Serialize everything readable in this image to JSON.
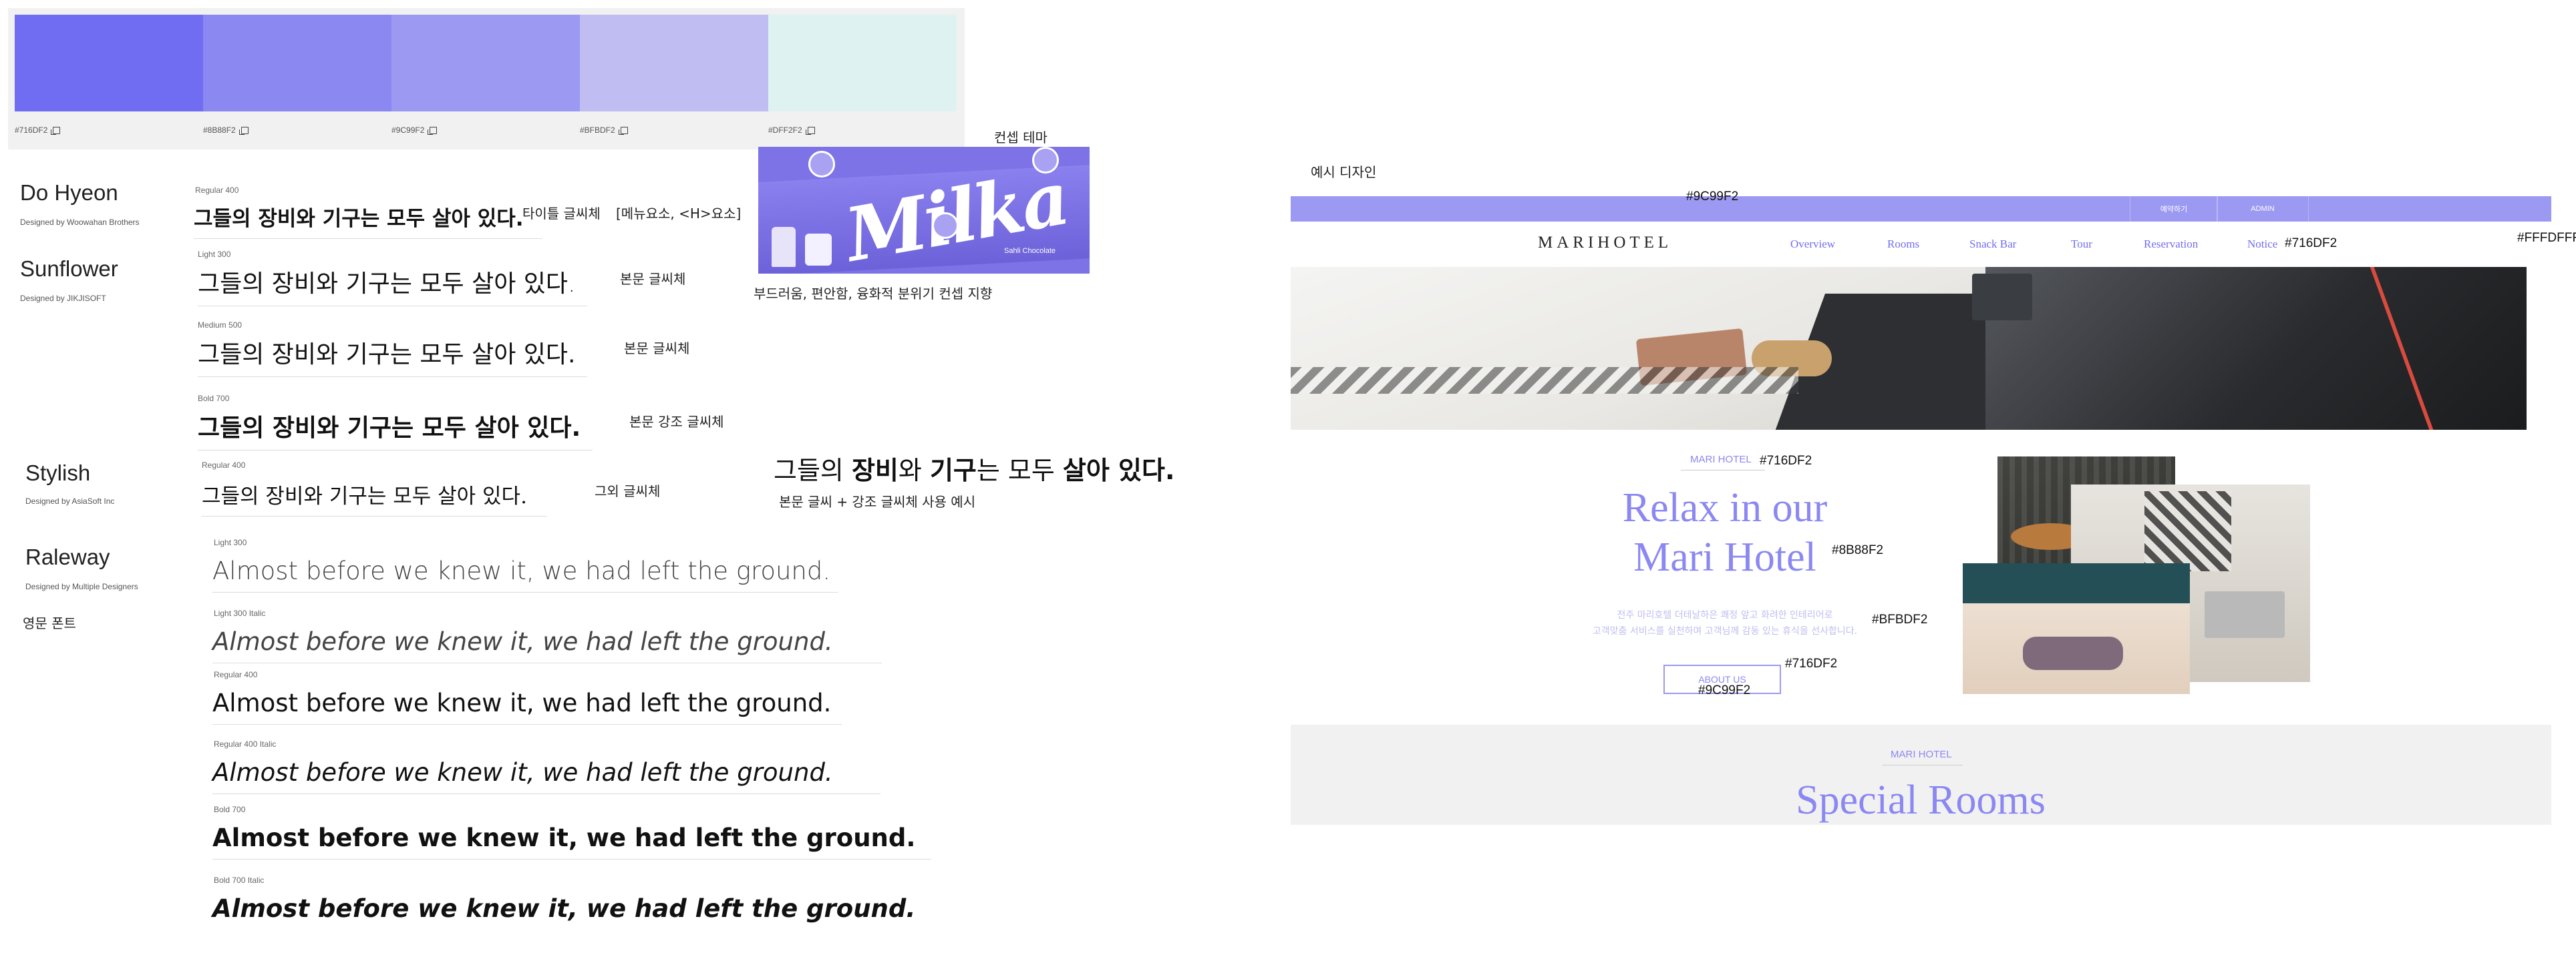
{
  "palette": {
    "swatches": [
      {
        "hex": "#716DF2",
        "color": "#716df2"
      },
      {
        "hex": "#8B88F2",
        "color": "#8b88f2"
      },
      {
        "hex": "#9C99F2",
        "color": "#9c99f2"
      },
      {
        "hex": "#BFBDF2",
        "color": "#bfbdf2"
      },
      {
        "hex": "#DFF2F2",
        "color": "#dff2f2"
      }
    ]
  },
  "fonts": {
    "do_hyeon": {
      "name": "Do Hyeon",
      "by": "Designed by Woowahan Brothers",
      "weight": "Regular 400",
      "sample": "그들의 장비와 기구는 모두 살아 있다.",
      "label": "타이틀 글씨체",
      "note": "[메뉴요소, <H>요소]"
    },
    "sunflower": {
      "name": "Sunflower",
      "by": "Designed by JIKJISOFT",
      "rows": [
        {
          "weight": "Light 300",
          "sample": "그들의 장비와 기구는 모두 살아 있다.",
          "label": "본문 글씨체"
        },
        {
          "weight": "Medium 500",
          "sample": "그들의 장비와 기구는 모두 살아 있다.",
          "label": "본문 글씨체"
        },
        {
          "weight": "Bold 700",
          "sample": "그들의 장비와 기구는 모두 살아 있다.",
          "label": "본문 강조 글씨체"
        }
      ]
    },
    "stylish": {
      "name": "Stylish",
      "by": "Designed by AsiaSoft Inc",
      "weight": "Regular 400",
      "sample": "그들의 장비와 기구는 모두 살아 있다.",
      "label": "그외 글씨체"
    },
    "raleway": {
      "name": "Raleway",
      "by": "Designed by Multiple Designers",
      "label": "영문 폰트",
      "rows": [
        {
          "weight": "Light 300",
          "sample": "Almost before we knew it, we had left the ground."
        },
        {
          "weight": "Light 300 Italic",
          "sample": "Almost before we knew it, we had left the ground."
        },
        {
          "weight": "Regular 400",
          "sample": "Almost before we knew it, we had left the ground."
        },
        {
          "weight": "Regular 400 Italic",
          "sample": "Almost before we knew it, we had left the ground."
        },
        {
          "weight": "Bold 700",
          "sample": "Almost before we knew it, we had left the ground."
        },
        {
          "weight": "Bold 700 Italic",
          "sample": "Almost before we knew it, we had left the ground."
        }
      ]
    }
  },
  "concept": {
    "title": "컨셉 테마",
    "logo": "Milka",
    "product": "Sahli Chocolate",
    "caption": "부드러움, 편안함, 융화적 분위기 컨셉 지향",
    "mixed_sample": {
      "p1": "그들의 ",
      "b1": "장비",
      "p2": "와 ",
      "b2": "기구",
      "p3": "는 모두 ",
      "b3": "살아 있다.",
      "caption": "본문 글씨 + 강조 글씨체 사용 예시"
    }
  },
  "mock": {
    "section_title": "예시 디자인",
    "topbar_color_label": "#9C99F2",
    "topbar_buttons": [
      "예약하기",
      "ADMIN"
    ],
    "brand": "MARIHOTEL",
    "nav": [
      "Overview",
      "Rooms",
      "Snack Bar",
      "Tour",
      "Reservation",
      "Notice"
    ],
    "nav_color_label": "#716DF2",
    "bg_label": "#FFFDFFF",
    "intro_label": "MARI HOTEL",
    "intro_label_color": "#716DF2",
    "headline_line1": "Relax in our",
    "headline_line2": "Mari Hotel",
    "headline_color": "#8B88F2",
    "body_line1": "전주 마리호텔 더테날하은 쾌정 앞고 화려한 인테리어로",
    "body_line2": "고객맞춤 서비스를 실천하며 고객님께 감동 있는 휴식을 선사합니다.",
    "body_color": "#BFBDF2",
    "button_label": "ABOUT US",
    "button_text_color": "#716DF2",
    "button_border_color": "#9C99F2",
    "rooms_label": "MARI HOTEL",
    "rooms_title": "Special Rooms"
  }
}
